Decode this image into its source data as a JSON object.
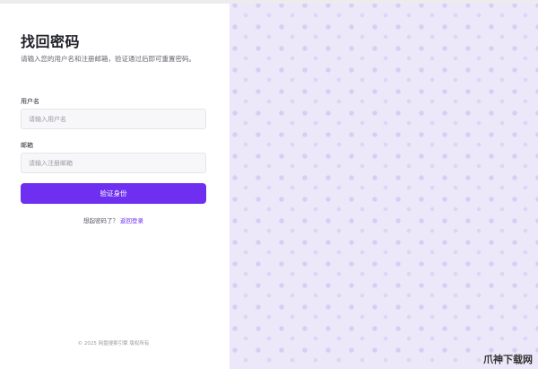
{
  "form": {
    "title": "找回密码",
    "subtitle": "请输入您的用户名和注册邮箱，验证通过后即可重置密码。",
    "username_label": "用户名",
    "username_placeholder": "请输入用户名",
    "email_label": "邮箱",
    "email_placeholder": "请输入注册邮箱",
    "submit_label": "验证身份",
    "remember_text": "想起密码了？",
    "back_link": "返回登录"
  },
  "footer": {
    "copyright": "© 2025 网盘搜索引擎 版权所有"
  },
  "watermark": {
    "text": "爪神下载网"
  },
  "colors": {
    "accent": "#6f2ff0",
    "right_panel_bg": "#ece8fa"
  }
}
